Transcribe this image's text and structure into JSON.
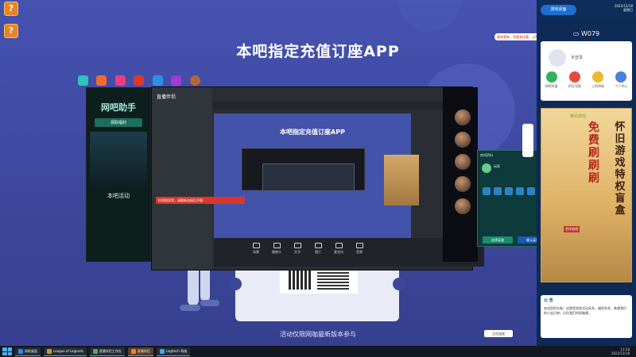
{
  "desktop": {
    "icons": [
      {
        "name": "desktop-icon-1",
        "label": "",
        "glyph": "?"
      },
      {
        "name": "desktop-icon-2",
        "label": "",
        "glyph": "?"
      }
    ],
    "banner_title": "本吧指定充值订座APP",
    "footer_note": "活动仅限网咖最新版本参与",
    "colors": {
      "bg": "#3f4aa3",
      "accent": "#1f6fd3",
      "warn": "#d9372b"
    }
  },
  "left_window": {
    "promo_title": "网吧助手",
    "promo_button": "领取福利",
    "activity": "本吧活动"
  },
  "main_window": {
    "title": "直播伴侣",
    "stage_title": "本吧指定充值订座APP",
    "error_text": "检测到异常，请重新连接后开播",
    "go_live": "开始直播",
    "toolbar": [
      {
        "name": "tool-scene",
        "label": "场景"
      },
      {
        "name": "tool-camera",
        "label": "摄像头"
      },
      {
        "name": "tool-text",
        "label": "文字"
      },
      {
        "name": "tool-image",
        "label": "图片"
      },
      {
        "name": "tool-mic",
        "label": "麦克风"
      },
      {
        "name": "tool-audio",
        "label": "音频"
      }
    ]
  },
  "popup": {
    "header": "房间资料",
    "player_name": "玩家",
    "buttons": [
      {
        "name": "popup-btn-left",
        "label": "选择英雄",
        "color": "#1b8c6d"
      },
      {
        "name": "popup-btn-right",
        "label": "确认英雄",
        "color": "#1a58b8"
      }
    ]
  },
  "right_panel": {
    "header_pill": "游戏桌面",
    "date_line1": "2022/12/18",
    "date_line2": "星期日",
    "machine": "W079",
    "user_name": "未登录",
    "quick_actions": [
      {
        "name": "action-recharge",
        "label": "网吧充值",
        "color": "#2fb45c"
      },
      {
        "name": "action-gift",
        "label": "积分兑换",
        "color": "#e84b3d"
      },
      {
        "name": "action-crown",
        "label": "上网特权",
        "color": "#f0b82a"
      },
      {
        "name": "action-user",
        "label": "个人中心",
        "color": "#4a7ee0"
      }
    ],
    "ad": {
      "brand": "腾讯游戏",
      "vertical_red": "免费刷刷刷",
      "vertical_dark": "怀旧游戏特权盲盒",
      "tag": "合作游戏"
    },
    "news": {
      "heading": "公 告",
      "body": "欢迎您的光临！这就是游戏活动多多，福利多多，希望我们的小宝贝带，记住我们的网咖哦。"
    }
  },
  "bubble_text": "喜欢就来，充值有优惠，让你畅玩",
  "notification": "正在连接",
  "taskbar": {
    "tasks": [
      {
        "name": "task-browser",
        "label": "网吧桌面",
        "color": "#2a8df0"
      },
      {
        "name": "task-lol",
        "label": "League of Legends",
        "color": "#c89b3c"
      },
      {
        "name": "task-chrome",
        "label": "直播伴侣工作台",
        "color": "#4caf50"
      },
      {
        "name": "task-live",
        "label": "直播伴侣",
        "color": "#e8833a"
      },
      {
        "name": "task-logi",
        "label": "Logitech 网络",
        "color": "#3fa7ff"
      }
    ],
    "time": "13:58",
    "date": "2022/12/18"
  }
}
